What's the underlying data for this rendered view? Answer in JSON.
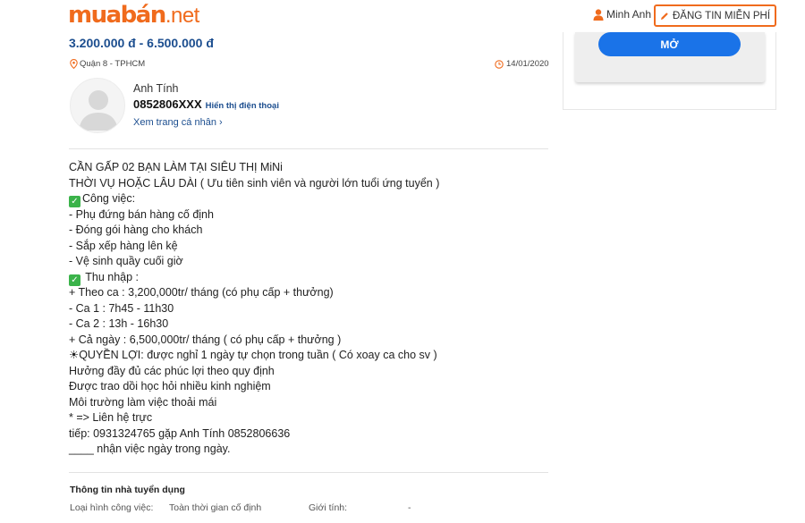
{
  "header": {
    "logo_main": "muabán",
    "logo_tld": ".net",
    "user_name": "Minh Anh",
    "post_button": "ĐĂNG TIN MIỄN PHÍ"
  },
  "sidebar": {
    "open_button": "MỞ"
  },
  "listing": {
    "price": "3.200.000 đ - 6.500.000 đ",
    "location": "Quận 8 - TPHCM",
    "date": "14/01/2020"
  },
  "seller": {
    "name": "Anh Tính",
    "phone": "0852806XXX",
    "show_phone": "Hiển thị điện thoại",
    "profile_link": "Xem trang cá nhân"
  },
  "description": {
    "lines": [
      "CẦN GẤP 02 BẠN LÀM TẠI SIÊU THỊ MiNi",
      "THỜI VỤ HOẶC LÂU DÀI ( Ưu tiên sinh viên và người lớn tuổi ứng tuyển )",
      "Công việc:",
      "- Phụ đứng bán hàng cố định",
      "- Đóng gói hàng cho khách",
      "- Sắp xếp hàng lên kệ",
      "- Vệ sinh quầy cuối giờ",
      " Thu nhập :",
      "+ Theo ca : 3,200,000tr/ tháng (có phụ cấp + thưởng)",
      "- Ca 1 : 7h45 - 11h30",
      "- Ca 2 : 13h - 16h30",
      "+ Cả ngày : 6,500,000tr/ tháng ( có phụ cấp + thưởng )",
      "☀QUYỀN LỢI: được nghỉ 1 ngày tự chọn trong tuần ( Có xoay ca cho sv )",
      "Hưởng đầy đủ các phúc lợi theo quy định",
      "Được trao dồi học hỏi nhiều kinh nghiệm",
      "Môi trường làm việc thoải mái",
      "* => Liên hệ trực",
      "tiếp: 0931324765 gặp Anh Tính 0852806636",
      "____ nhận việc ngày trong ngày."
    ]
  },
  "employer_info": {
    "title": "Thông tin nhà tuyển dụng",
    "job_type_label": "Loại hình công việc:",
    "job_type_value": "Toàn thời gian cố định",
    "gender_label": "Giới tính:",
    "gender_value": "-"
  },
  "colors": {
    "brand_orange": "#f06b1d",
    "link_blue": "#1c4e8f",
    "button_blue": "#1a73e8",
    "check_green": "#3bb34a"
  }
}
